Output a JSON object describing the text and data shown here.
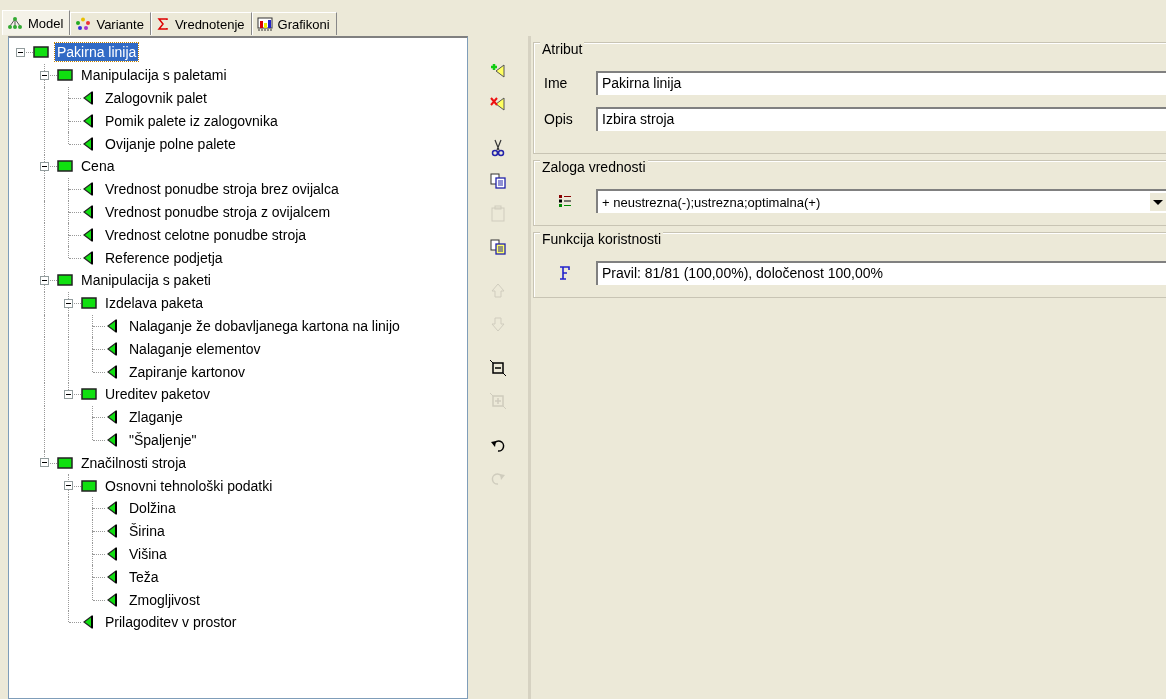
{
  "tabs": [
    {
      "label": "Model",
      "kind": "model",
      "selected": true
    },
    {
      "label": "Variante",
      "kind": "variants",
      "selected": false
    },
    {
      "label": "Vrednotenje",
      "kind": "sigma",
      "selected": false
    },
    {
      "label": "Grafikoni",
      "kind": "chart",
      "selected": false
    }
  ],
  "tree": [
    {
      "label": "Pakirna linija",
      "kind": "group",
      "expanded": true,
      "selected": true,
      "children": [
        {
          "label": "Manipulacija s paletami",
          "kind": "group",
          "expanded": true,
          "selected": false,
          "children": [
            {
              "label": "Zalogovnik palet",
              "kind": "leaf",
              "selected": false
            },
            {
              "label": "Pomik palete iz zalogovnika",
              "kind": "leaf",
              "selected": false
            },
            {
              "label": "Ovijanje polne palete",
              "kind": "leaf",
              "selected": false
            }
          ]
        },
        {
          "label": "Cena",
          "kind": "group",
          "expanded": true,
          "selected": false,
          "children": [
            {
              "label": "Vrednost ponudbe stroja brez ovijalca",
              "kind": "leaf",
              "selected": false
            },
            {
              "label": "Vrednost ponudbe stroja z ovijalcem",
              "kind": "leaf",
              "selected": false
            },
            {
              "label": "Vrednost celotne ponudbe stroja",
              "kind": "leaf",
              "selected": false
            },
            {
              "label": "Reference podjetja",
              "kind": "leaf",
              "selected": false
            }
          ]
        },
        {
          "label": "Manipulacija s paketi",
          "kind": "group",
          "expanded": true,
          "selected": false,
          "children": [
            {
              "label": "Izdelava paketa",
              "kind": "group",
              "expanded": true,
              "selected": false,
              "children": [
                {
                  "label": "Nalaganje že dobavljanega kartona na linijo",
                  "kind": "leaf",
                  "selected": false
                },
                {
                  "label": "Nalaganje elementov",
                  "kind": "leaf",
                  "selected": false
                },
                {
                  "label": "Zapiranje kartonov",
                  "kind": "leaf",
                  "selected": false
                }
              ]
            },
            {
              "label": "Ureditev paketov",
              "kind": "group",
              "expanded": true,
              "selected": false,
              "children": [
                {
                  "label": "Zlaganje",
                  "kind": "leaf",
                  "selected": false
                },
                {
                  "label": "\"Špaljenje\"",
                  "kind": "leaf",
                  "selected": false
                }
              ]
            }
          ]
        },
        {
          "label": "Značilnosti stroja",
          "kind": "group",
          "expanded": true,
          "selected": false,
          "children": [
            {
              "label": "Osnovni tehnološki podatki",
              "kind": "group",
              "expanded": true,
              "selected": false,
              "children": [
                {
                  "label": "Dolžina",
                  "kind": "leaf",
                  "selected": false
                },
                {
                  "label": "Širina",
                  "kind": "leaf",
                  "selected": false
                },
                {
                  "label": "Višina",
                  "kind": "leaf",
                  "selected": false
                },
                {
                  "label": "Teža",
                  "kind": "leaf",
                  "selected": false
                },
                {
                  "label": "Zmogljivost",
                  "kind": "leaf",
                  "selected": false
                }
              ]
            },
            {
              "label": "Prilagoditev v prostor",
              "kind": "leaf",
              "selected": false
            }
          ]
        }
      ]
    }
  ],
  "toolbar": [
    [
      {
        "kind": "add",
        "disabled": false
      },
      {
        "kind": "delete",
        "disabled": false
      }
    ],
    [
      {
        "kind": "cut",
        "disabled": false
      },
      {
        "kind": "copy",
        "disabled": false
      },
      {
        "kind": "paste",
        "disabled": true
      },
      {
        "kind": "copy2",
        "disabled": false
      }
    ],
    [
      {
        "kind": "up",
        "disabled": true
      },
      {
        "kind": "down",
        "disabled": true
      }
    ],
    [
      {
        "kind": "collapse",
        "disabled": false
      },
      {
        "kind": "expand",
        "disabled": true
      }
    ],
    [
      {
        "kind": "undo",
        "disabled": false
      },
      {
        "kind": "redo",
        "disabled": true
      }
    ]
  ],
  "attribute": {
    "title": "Atribut",
    "fields": [
      {
        "label": "Ime",
        "value": "Pakirna linija"
      },
      {
        "label": "Opis",
        "value": "Izbira stroja"
      }
    ]
  },
  "value_scale": {
    "title": "Zaloga vrednosti",
    "value": "+ neustrezna(-);ustrezna;optimalna(+)"
  },
  "utility_function": {
    "title": "Funkcija koristnosti",
    "value": "Pravil: 81/81 (100,00%), določenost 100,00%"
  }
}
